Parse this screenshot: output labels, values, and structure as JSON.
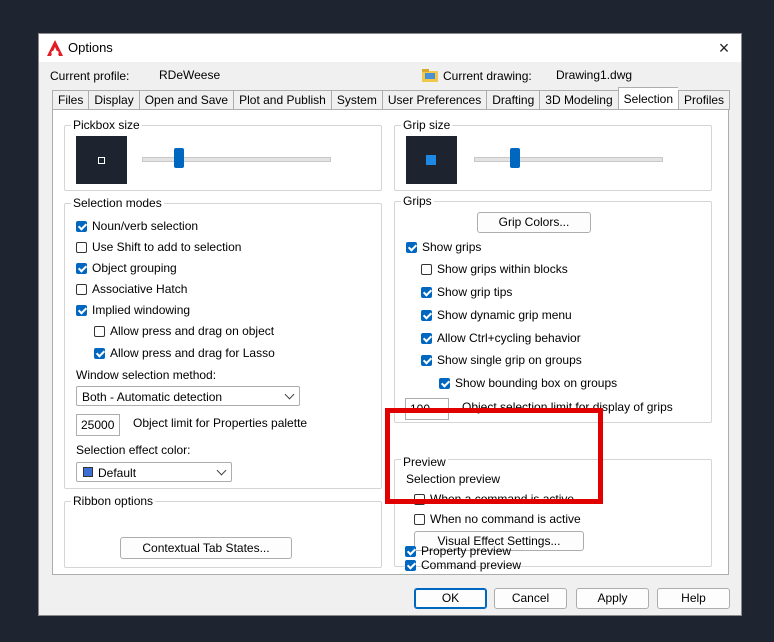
{
  "window": {
    "title": "Options",
    "close": "×"
  },
  "profile": {
    "label": "Current profile:",
    "value": "RDeWeese"
  },
  "drawing": {
    "label": "Current drawing:",
    "value": "Drawing1.dwg"
  },
  "tabs": [
    "Files",
    "Display",
    "Open and Save",
    "Plot and Publish",
    "System",
    "User Preferences",
    "Drafting",
    "3D Modeling",
    "Selection",
    "Profiles"
  ],
  "active_tab": "Selection",
  "pickbox": {
    "label": "Pickbox size",
    "slider_fraction": 0.2
  },
  "grip_size": {
    "label": "Grip size",
    "slider_fraction": 0.22
  },
  "selection_modes": {
    "label": "Selection modes",
    "items": [
      {
        "label": "Noun/verb selection",
        "checked": true
      },
      {
        "label": "Use Shift to add to selection",
        "checked": false
      },
      {
        "label": "Object grouping",
        "checked": true
      },
      {
        "label": "Associative Hatch",
        "checked": false
      },
      {
        "label": "Implied windowing",
        "checked": true
      },
      {
        "label": "Allow press and drag on object",
        "checked": false
      },
      {
        "label": "Allow press and drag for Lasso",
        "checked": true
      }
    ],
    "window_method_label": "Window selection method:",
    "window_method_value": "Both - Automatic detection",
    "object_limit_value": "25000",
    "object_limit_label": "Object limit for Properties palette",
    "effect_color_label": "Selection effect color:",
    "effect_color_value": "Default",
    "effect_color_swatch": "#3b6fd6"
  },
  "ribbon": {
    "label": "Ribbon options",
    "button": "Contextual Tab States..."
  },
  "grips": {
    "label": "Grips",
    "colors_button": "Grip Colors...",
    "items": [
      {
        "label": "Show grips",
        "checked": true
      },
      {
        "label": "Show grips within blocks",
        "checked": false
      },
      {
        "label": "Show grip tips",
        "checked": true
      },
      {
        "label": "Show dynamic grip menu",
        "checked": true
      },
      {
        "label": "Allow Ctrl+cycling behavior",
        "checked": true
      },
      {
        "label": "Show single grip on groups",
        "checked": true
      },
      {
        "label": "Show bounding box on groups",
        "checked": true
      }
    ],
    "limit_value": "100",
    "limit_label": "Object selection limit for display of grips"
  },
  "preview": {
    "label": "Preview",
    "sub_label": "Selection preview",
    "items": [
      {
        "label": "When a command is active",
        "checked": false
      },
      {
        "label": "When no command is active",
        "checked": false
      }
    ],
    "effects_button": "Visual Effect Settings...",
    "command_preview": {
      "label": "Command preview",
      "checked": true
    },
    "property_preview": {
      "label": "Property preview",
      "checked": true
    }
  },
  "footer": {
    "ok": "OK",
    "cancel": "Cancel",
    "apply": "Apply",
    "help": "Help"
  },
  "colors": {
    "accent": "#0067c0",
    "highlight": "#e00000",
    "preview_bg": "#1d2430"
  }
}
